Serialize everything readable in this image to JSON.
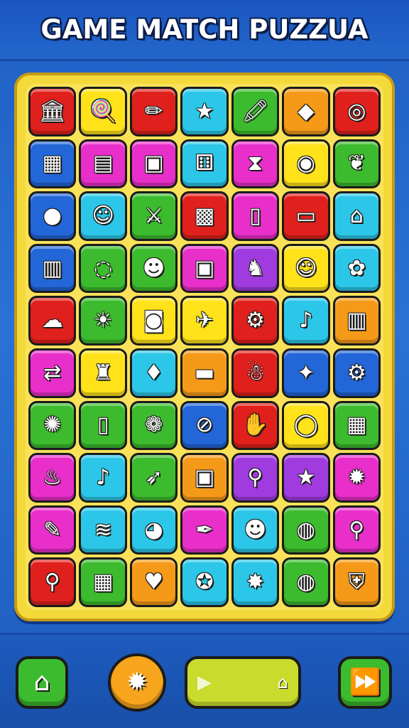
{
  "title": "GAME MATCH PUZZUA",
  "palette": {
    "red": "#e0201c",
    "yellow": "#ffe21a",
    "orange": "#f59a18",
    "cyan": "#2cc7e8",
    "green": "#3dbb2e",
    "magenta": "#e82fc9",
    "blue": "#2266d8",
    "purple": "#a03be0"
  },
  "board": {
    "rows": [
      [
        {
          "color": "red",
          "icon": "temple-icon",
          "glyph": "🏛"
        },
        {
          "color": "yellow",
          "icon": "lollipop-icon",
          "glyph": "🍭"
        },
        {
          "color": "red",
          "icon": "pencil-icon",
          "glyph": "✏"
        },
        {
          "color": "cyan",
          "icon": "star-icon",
          "glyph": "★"
        },
        {
          "color": "green",
          "icon": "crayon-icon",
          "glyph": "🖍"
        },
        {
          "color": "orange",
          "icon": "gem-icon",
          "glyph": "◆"
        },
        {
          "color": "red",
          "icon": "swirl-icon",
          "glyph": "◎"
        }
      ],
      [
        {
          "color": "blue",
          "icon": "building-icon",
          "glyph": "▦"
        },
        {
          "color": "magenta",
          "icon": "phone-icon",
          "glyph": "▤"
        },
        {
          "color": "magenta",
          "icon": "calculator-icon",
          "glyph": "▣"
        },
        {
          "color": "cyan",
          "icon": "dice-icon",
          "glyph": "⚅"
        },
        {
          "color": "magenta",
          "icon": "hourglass-icon",
          "glyph": "⧗"
        },
        {
          "color": "yellow",
          "icon": "ring-icon",
          "glyph": "◉"
        },
        {
          "color": "green",
          "icon": "leaf-icon",
          "glyph": "❦"
        }
      ],
      [
        {
          "color": "blue",
          "icon": "apple-icon",
          "glyph": "●"
        },
        {
          "color": "cyan",
          "icon": "face-icon",
          "glyph": "☺"
        },
        {
          "color": "green",
          "icon": "sword-icon",
          "glyph": "⚔"
        },
        {
          "color": "red",
          "icon": "box-icon",
          "glyph": "▩"
        },
        {
          "color": "magenta",
          "icon": "card-icon",
          "glyph": "▯"
        },
        {
          "color": "red",
          "icon": "tablet-icon",
          "glyph": "▭"
        },
        {
          "color": "cyan",
          "icon": "carousel-icon",
          "glyph": "⌂"
        }
      ],
      [
        {
          "color": "blue",
          "icon": "barrel-icon",
          "glyph": "▥"
        },
        {
          "color": "green",
          "icon": "donut-icon",
          "glyph": "◌"
        },
        {
          "color": "green",
          "icon": "devil-icon",
          "glyph": "☻"
        },
        {
          "color": "magenta",
          "icon": "robot-icon",
          "glyph": "▣"
        },
        {
          "color": "purple",
          "icon": "unicorn-icon",
          "glyph": "♞"
        },
        {
          "color": "yellow",
          "icon": "smiley-icon",
          "glyph": "☺"
        },
        {
          "color": "cyan",
          "icon": "flower-icon",
          "glyph": "✿"
        }
      ],
      [
        {
          "color": "red",
          "icon": "cloud-icon",
          "glyph": "☁"
        },
        {
          "color": "green",
          "icon": "sun-monster-icon",
          "glyph": "☀"
        },
        {
          "color": "yellow",
          "icon": "camera-icon",
          "glyph": "◙"
        },
        {
          "color": "yellow",
          "icon": "plane-icon",
          "glyph": "✈"
        },
        {
          "color": "red",
          "icon": "gear-icon",
          "glyph": "⚙"
        },
        {
          "color": "cyan",
          "icon": "lollipop-icon",
          "glyph": "♪"
        },
        {
          "color": "orange",
          "icon": "chart-icon",
          "glyph": "▥"
        }
      ],
      [
        {
          "color": "magenta",
          "icon": "arrows-icon",
          "glyph": "⇄"
        },
        {
          "color": "yellow",
          "icon": "bottle-icon",
          "glyph": "♜"
        },
        {
          "color": "cyan",
          "icon": "bird-icon",
          "glyph": "♦"
        },
        {
          "color": "orange",
          "icon": "bandage-icon",
          "glyph": "▬"
        },
        {
          "color": "red",
          "icon": "ghost-icon",
          "glyph": "☃"
        },
        {
          "color": "blue",
          "icon": "fidget-icon",
          "glyph": "✦"
        },
        {
          "color": "blue",
          "icon": "puzzle-gear-icon",
          "glyph": "⚙"
        }
      ],
      [
        {
          "color": "green",
          "icon": "fish-icon",
          "glyph": "✺"
        },
        {
          "color": "green",
          "icon": "smartphone-icon",
          "glyph": "▯"
        },
        {
          "color": "green",
          "icon": "flower-gear-icon",
          "glyph": "❁"
        },
        {
          "color": "blue",
          "icon": "lens-icon",
          "glyph": "⊘"
        },
        {
          "color": "red",
          "icon": "hand-icon",
          "glyph": "✋"
        },
        {
          "color": "yellow",
          "icon": "ring-donut-icon",
          "glyph": "◯"
        },
        {
          "color": "green",
          "icon": "gift-icon",
          "glyph": "▦"
        }
      ],
      [
        {
          "color": "magenta",
          "icon": "teapot-icon",
          "glyph": "♨"
        },
        {
          "color": "cyan",
          "icon": "hook-icon",
          "glyph": "♪"
        },
        {
          "color": "green",
          "icon": "rocket-icon",
          "glyph": "➶"
        },
        {
          "color": "orange",
          "icon": "photo-icon",
          "glyph": "▣"
        },
        {
          "color": "purple",
          "icon": "wand-icon",
          "glyph": "⚲"
        },
        {
          "color": "purple",
          "icon": "starfish-icon",
          "glyph": "★"
        },
        {
          "color": "magenta",
          "icon": "cog-icon",
          "glyph": "✹"
        }
      ],
      [
        {
          "color": "magenta",
          "icon": "pen-icon",
          "glyph": "✎"
        },
        {
          "color": "cyan",
          "icon": "coil-icon",
          "glyph": "≋"
        },
        {
          "color": "cyan",
          "icon": "cookie-icon",
          "glyph": "◕"
        },
        {
          "color": "magenta",
          "icon": "quill-icon",
          "glyph": "✒"
        },
        {
          "color": "cyan",
          "icon": "robot-face-icon",
          "glyph": "☻"
        },
        {
          "color": "green",
          "icon": "pizza-icon",
          "glyph": "◍"
        },
        {
          "color": "magenta",
          "icon": "magnifier-icon",
          "glyph": "⚲"
        }
      ],
      [
        {
          "color": "red",
          "icon": "spoon-icon",
          "glyph": "⚲"
        },
        {
          "color": "green",
          "icon": "house-icon",
          "glyph": "▦"
        },
        {
          "color": "orange",
          "icon": "shield-heart-icon",
          "glyph": "♥"
        },
        {
          "color": "cyan",
          "icon": "star-badge-icon",
          "glyph": "✪"
        },
        {
          "color": "cyan",
          "icon": "splat-icon",
          "glyph": "✸"
        },
        {
          "color": "green",
          "icon": "orb-icon",
          "glyph": "◍"
        },
        {
          "color": "orange",
          "icon": "shield-icon",
          "glyph": "⛨"
        }
      ]
    ]
  },
  "controls": {
    "home_icon": "⌂",
    "settings_icon": "✹",
    "play_icon": "▶",
    "house_icon": "⌂",
    "fast_forward_icon": "⏩"
  }
}
